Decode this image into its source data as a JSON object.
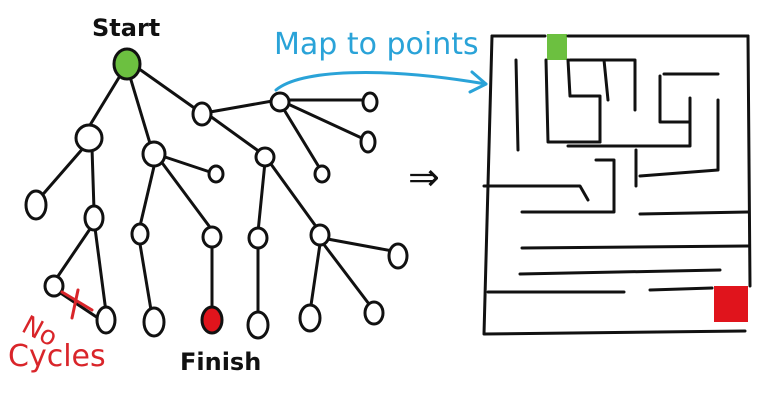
{
  "labels": {
    "start": "Start",
    "finish": "Finish",
    "map_to_points": "Map to points",
    "no": "No",
    "cycles": "Cycles",
    "implies": "⇒"
  },
  "colors": {
    "ink": "#111111",
    "start_fill": "#6cc040",
    "finish_fill": "#e0141c",
    "map_arrow": "#2aa3d8",
    "no_cycles": "#d9252a"
  }
}
